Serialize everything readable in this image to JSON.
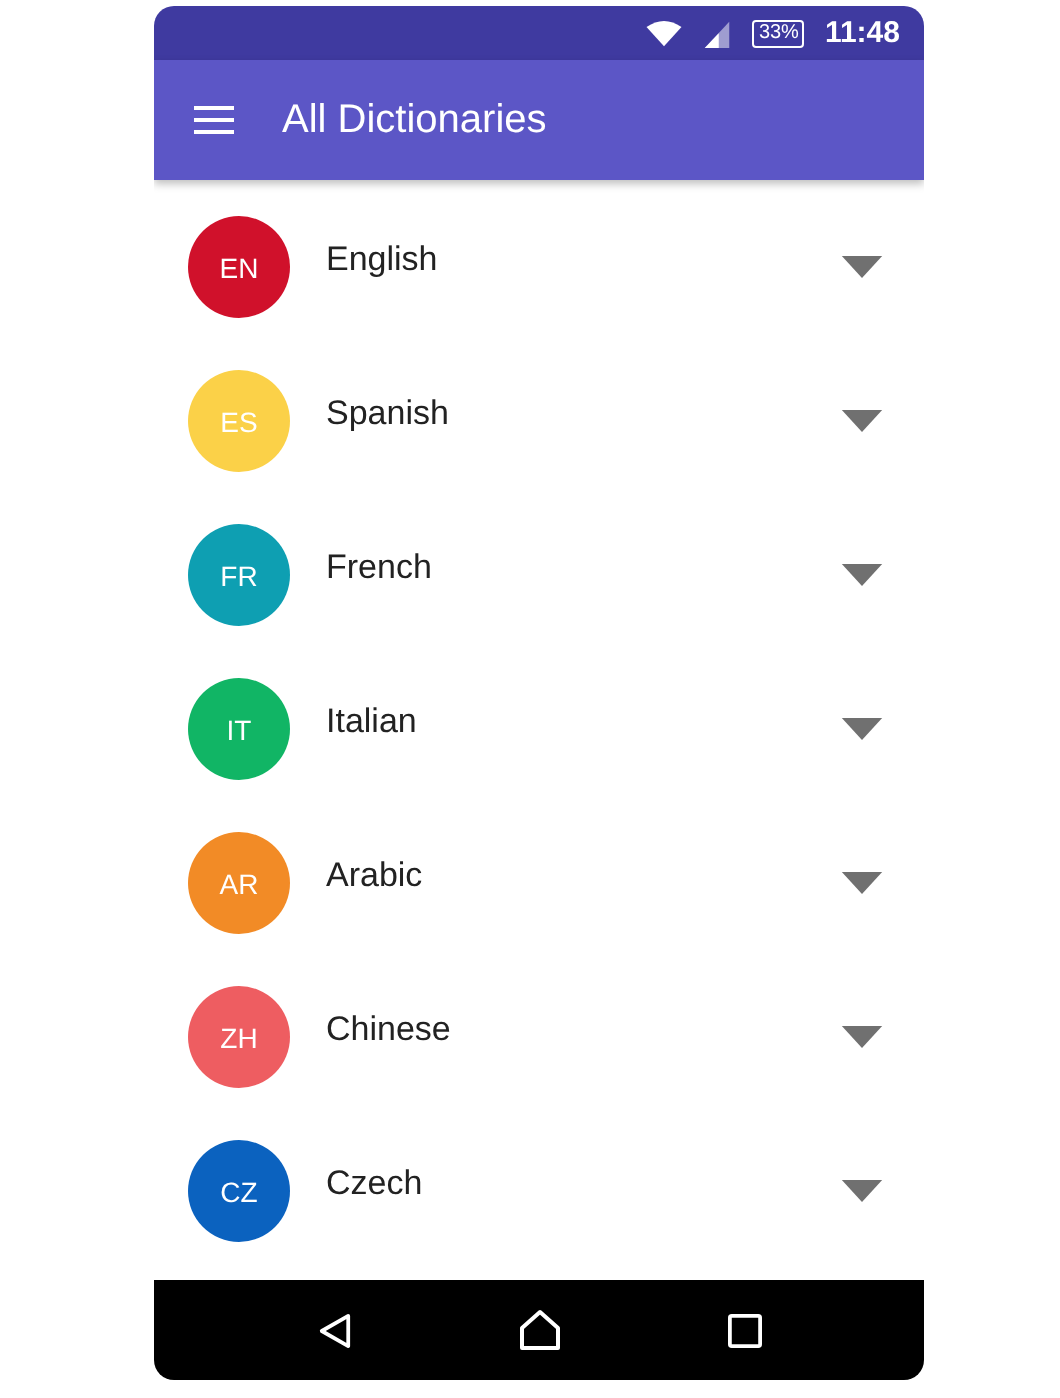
{
  "status_bar": {
    "battery": "33%",
    "time": "11:48"
  },
  "app_bar": {
    "title": "All Dictionaries"
  },
  "dictionaries": [
    {
      "code": "EN",
      "name": "English",
      "color": "#d0112b"
    },
    {
      "code": "ES",
      "name": "Spanish",
      "color": "#fbd148"
    },
    {
      "code": "FR",
      "name": "French",
      "color": "#0e9fb2"
    },
    {
      "code": "IT",
      "name": "Italian",
      "color": "#11b565"
    },
    {
      "code": "AR",
      "name": "Arabic",
      "color": "#f28b26"
    },
    {
      "code": "ZH",
      "name": "Chinese",
      "color": "#ee5d61"
    },
    {
      "code": "CZ",
      "name": "Czech",
      "color": "#0b62bf"
    }
  ]
}
